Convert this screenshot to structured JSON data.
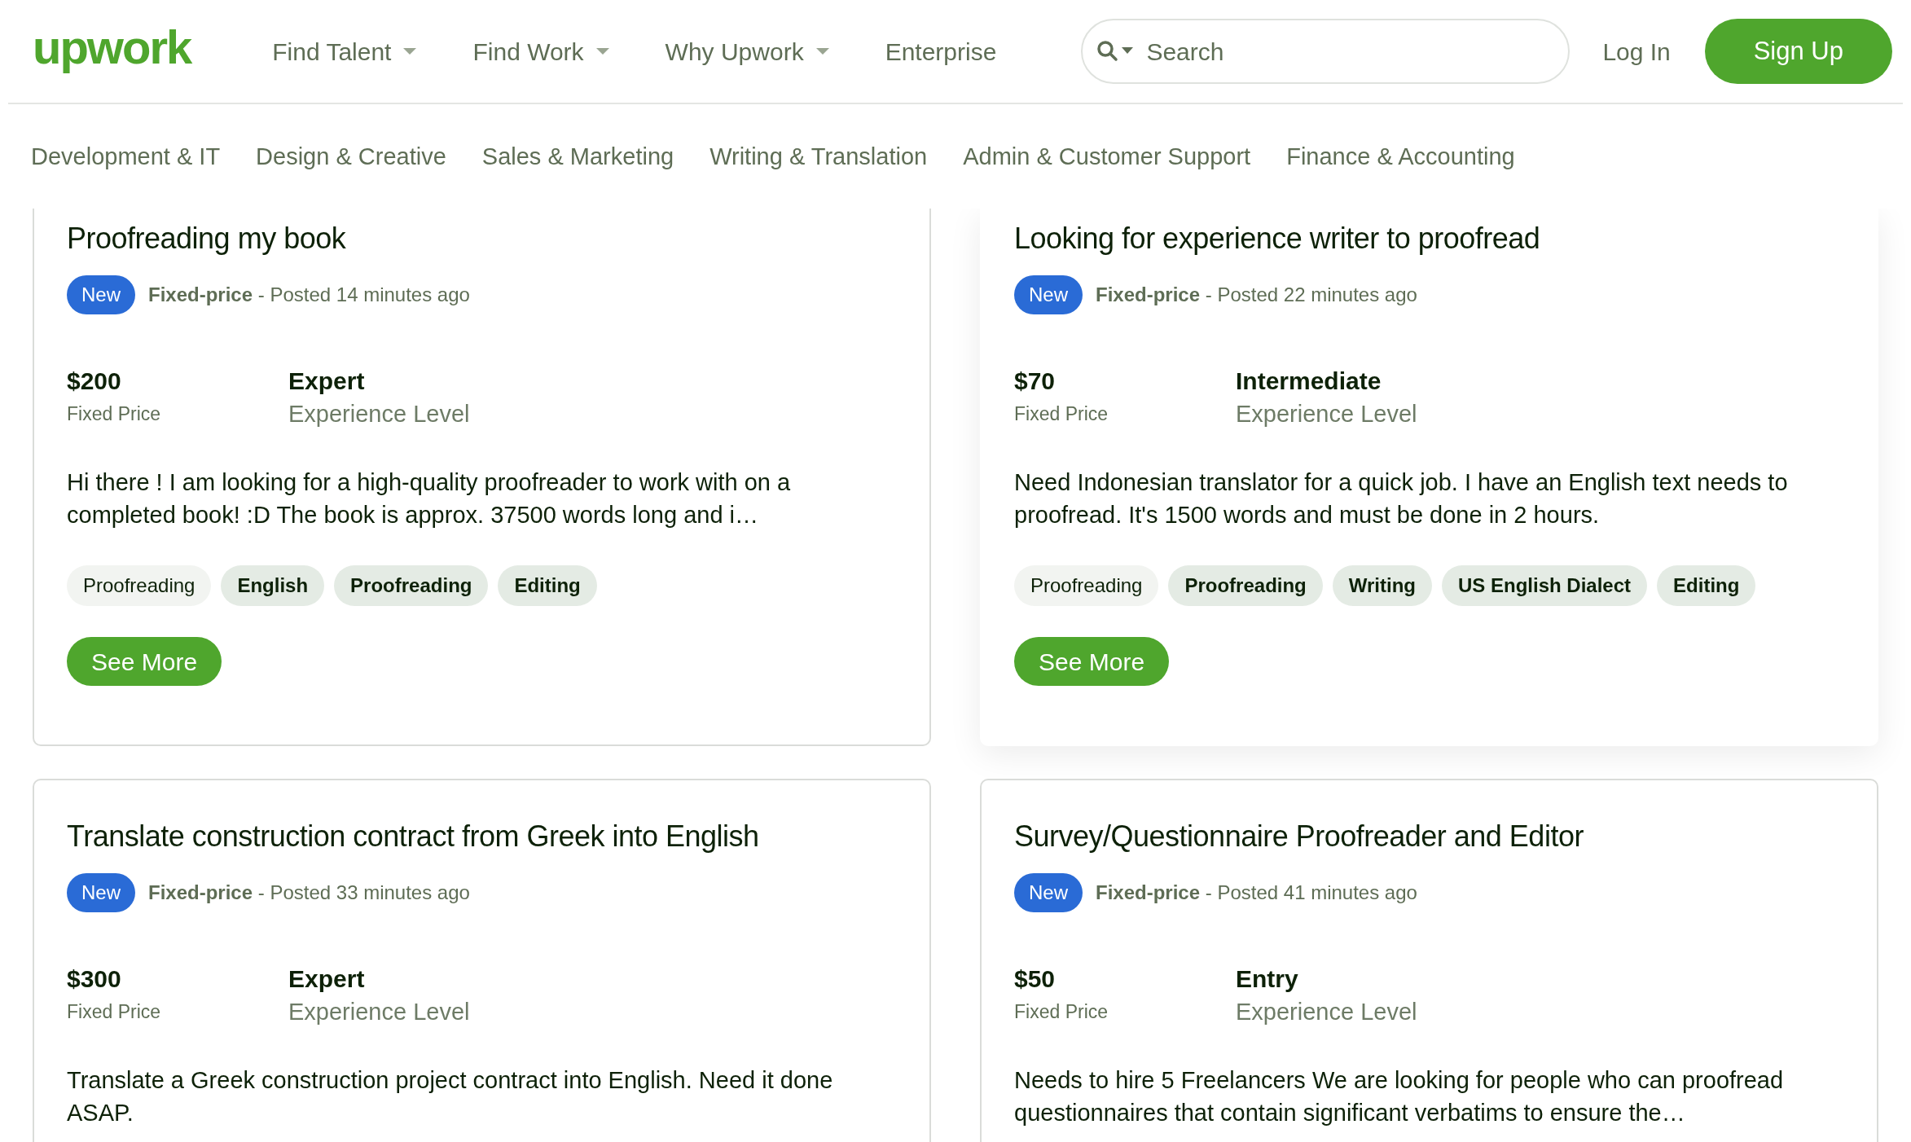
{
  "header": {
    "logo": "upwork",
    "nav": [
      {
        "label": "Find Talent",
        "has_menu": true
      },
      {
        "label": "Find Work",
        "has_menu": true
      },
      {
        "label": "Why Upwork",
        "has_menu": true
      },
      {
        "label": "Enterprise",
        "has_menu": false
      }
    ],
    "search": {
      "placeholder": "Search"
    },
    "login": "Log In",
    "signup": "Sign Up"
  },
  "categories": [
    "Development & IT",
    "Design & Creative",
    "Sales & Marketing",
    "Writing & Translation",
    "Admin & Customer Support",
    "Finance & Accounting"
  ],
  "jobs": [
    {
      "title": "Proofreading my book",
      "raised": false,
      "badge": "New",
      "type": "Fixed-price",
      "posted": "- Posted 14 minutes ago",
      "price": "$200",
      "price_label": "Fixed Price",
      "level": "Expert",
      "level_label": "Experience Level",
      "description": "Hi there ! I am looking for a high-quality proofreader to work with on a completed book! :D The book is approx. 37500 words long and i…",
      "tags": [
        {
          "label": "Proofreading",
          "kind": "category"
        },
        {
          "label": "English",
          "kind": "skill"
        },
        {
          "label": "Proofreading",
          "kind": "skill"
        },
        {
          "label": "Editing",
          "kind": "skill"
        }
      ],
      "button": "See More"
    },
    {
      "title": "Looking for experience writer to proofread",
      "raised": true,
      "badge": "New",
      "type": "Fixed-price",
      "posted": "- Posted 22 minutes ago",
      "price": "$70",
      "price_label": "Fixed Price",
      "level": "Intermediate",
      "level_label": "Experience Level",
      "description": "Need Indonesian translator for a quick job. I have an English text needs to proofread. It's 1500 words and must be done in 2 hours.",
      "tags": [
        {
          "label": "Proofreading",
          "kind": "category"
        },
        {
          "label": "Proofreading",
          "kind": "skill"
        },
        {
          "label": "Writing",
          "kind": "skill"
        },
        {
          "label": "US English Dialect",
          "kind": "skill"
        },
        {
          "label": "Editing",
          "kind": "skill"
        }
      ],
      "button": "See More"
    },
    {
      "title": "Translate construction contract from Greek into English",
      "raised": false,
      "badge": "New",
      "type": "Fixed-price",
      "posted": "- Posted 33 minutes ago",
      "price": "$300",
      "price_label": "Fixed Price",
      "level": "Expert",
      "level_label": "Experience Level",
      "description": "Translate a Greek construction project contract into English. Need it done ASAP."
    },
    {
      "title": "Survey/Questionnaire Proofreader and Editor",
      "raised": false,
      "badge": "New",
      "type": "Fixed-price",
      "posted": "- Posted 41 minutes ago",
      "price": "$50",
      "price_label": "Fixed Price",
      "level": "Entry",
      "level_label": "Experience Level",
      "description": "Needs to hire 5 Freelancers We are looking for people who can proofread questionnaires that contain significant verbatims to ensure the…"
    }
  ]
}
